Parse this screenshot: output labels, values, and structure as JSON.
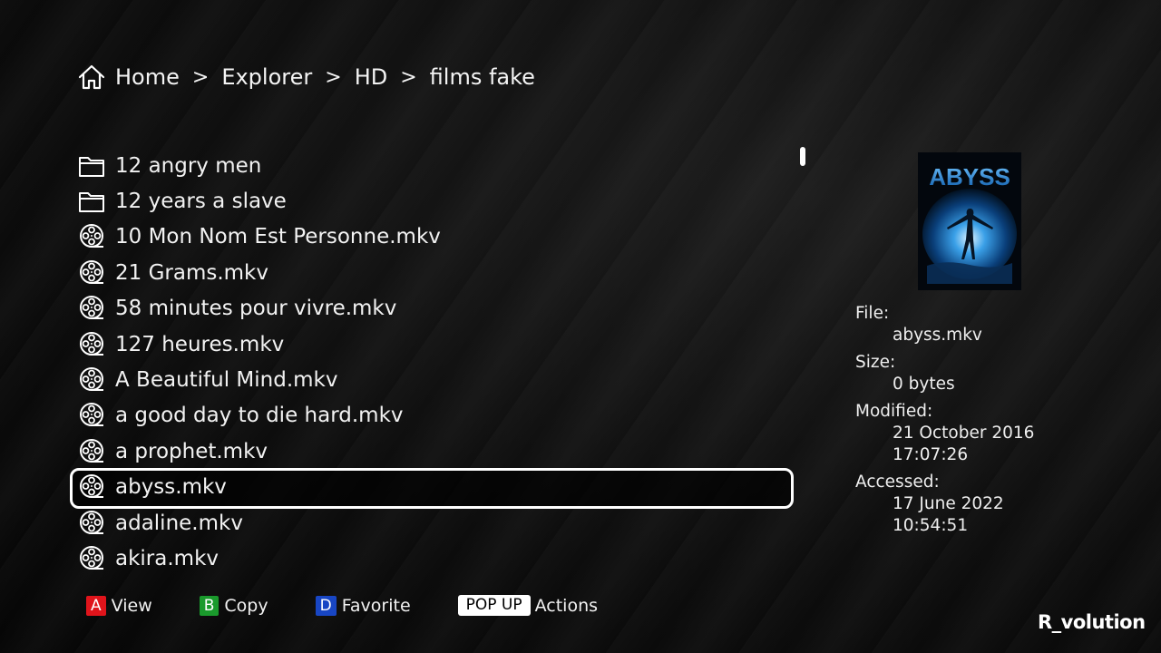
{
  "breadcrumb": {
    "icon": "home-icon",
    "items": [
      "Home",
      "Explorer",
      "HD",
      "films fake"
    ],
    "separator": ">"
  },
  "files": [
    {
      "name": "12 angry men",
      "type": "folder",
      "icon": "folder-icon"
    },
    {
      "name": "12 years a slave",
      "type": "folder",
      "icon": "folder-icon"
    },
    {
      "name": "10 Mon Nom Est Personne.mkv",
      "type": "video",
      "icon": "film-reel-icon"
    },
    {
      "name": "21 Grams.mkv",
      "type": "video",
      "icon": "film-reel-icon"
    },
    {
      "name": "58 minutes pour vivre.mkv",
      "type": "video",
      "icon": "film-reel-icon"
    },
    {
      "name": "127 heures.mkv",
      "type": "video",
      "icon": "film-reel-icon"
    },
    {
      "name": "A Beautiful Mind.mkv",
      "type": "video",
      "icon": "film-reel-icon"
    },
    {
      "name": "a good day to die hard.mkv",
      "type": "video",
      "icon": "film-reel-icon"
    },
    {
      "name": "a prophet.mkv",
      "type": "video",
      "icon": "film-reel-icon"
    },
    {
      "name": "abyss.mkv",
      "type": "video",
      "icon": "film-reel-icon",
      "selected": true
    },
    {
      "name": "adaline.mkv",
      "type": "video",
      "icon": "film-reel-icon"
    },
    {
      "name": "akira.mkv",
      "type": "video",
      "icon": "film-reel-icon"
    }
  ],
  "poster": {
    "title": "ABYSS"
  },
  "info": {
    "file_label": "File:",
    "file_value": "abyss.mkv",
    "size_label": "Size:",
    "size_value": "0 bytes",
    "modified_label": "Modified:",
    "modified_date": "21 October 2016",
    "modified_time": "17:07:26",
    "accessed_label": "Accessed:",
    "accessed_date": "17 June 2022",
    "accessed_time": "10:54:51"
  },
  "footer": {
    "view": {
      "key": "A",
      "label": "View",
      "color": "#e0141b"
    },
    "copy": {
      "key": "B",
      "label": "Copy",
      "color": "#1a9a2c"
    },
    "favorite": {
      "key": "D",
      "label": "Favorite",
      "color": "#1846c4"
    },
    "popup": {
      "key": "POP UP",
      "label": "Actions"
    }
  },
  "brand": "R_volution"
}
